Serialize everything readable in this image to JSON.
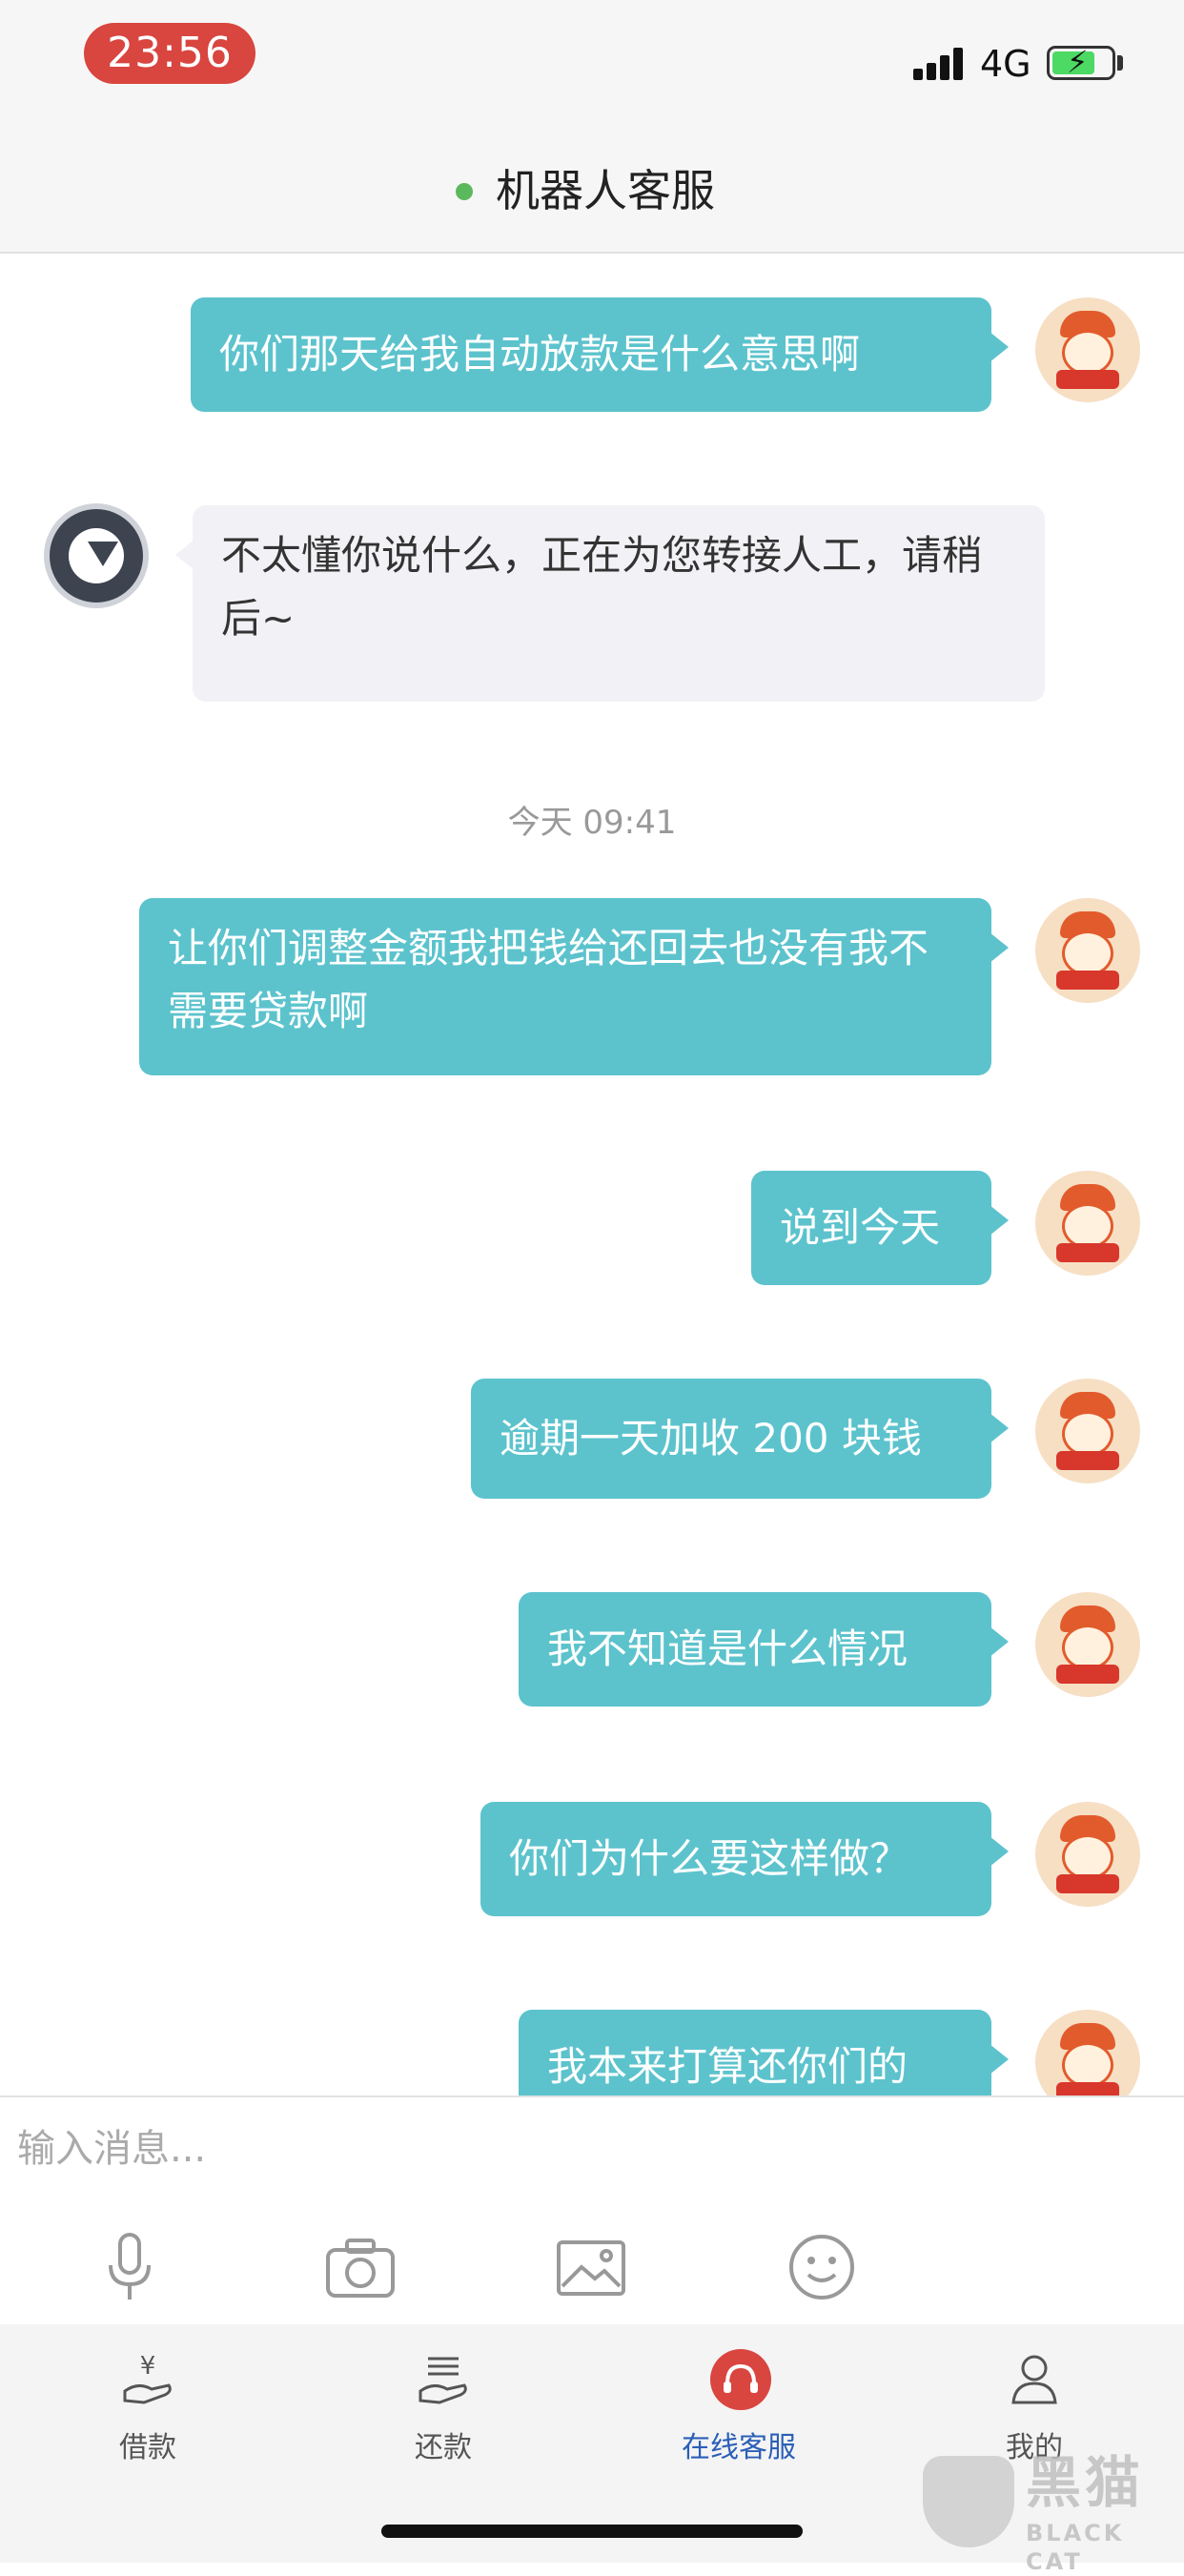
{
  "status_bar": {
    "time": "23:56",
    "network": "4G"
  },
  "header": {
    "title": "机器人客服",
    "online_color": "#5cb85c"
  },
  "messages": [
    {
      "sender": "user",
      "text": "你们那天给我自动放款是什么意思啊"
    },
    {
      "sender": "bot",
      "text": "不太懂你说什么，正在为您转接人工，请稍后~"
    },
    {
      "sender": "user",
      "text": "让你们调整金额我把钱给还回去也没有我不需要贷款啊"
    },
    {
      "sender": "user",
      "text": "说到今天"
    },
    {
      "sender": "user",
      "text": "逾期一天加收 200 块钱"
    },
    {
      "sender": "user",
      "text": "我不知道是什么情况"
    },
    {
      "sender": "user",
      "text": "你们为什么要这样做？"
    },
    {
      "sender": "user",
      "text": "我本来打算还你们的"
    }
  ],
  "timestamp": "今天 09:41",
  "input": {
    "placeholder": "输入消息..."
  },
  "toolbar": {
    "icons": [
      "microphone-icon",
      "camera-icon",
      "image-icon",
      "emoji-icon"
    ]
  },
  "tabs": [
    {
      "label": "借款",
      "icon": "loan-icon",
      "active": false
    },
    {
      "label": "还款",
      "icon": "repay-icon",
      "active": false
    },
    {
      "label": "在线客服",
      "icon": "headset-icon",
      "active": true
    },
    {
      "label": "我的",
      "icon": "profile-icon",
      "active": false
    }
  ],
  "colors": {
    "user_bubble": "#5cc3cd",
    "bot_bubble": "#f2f2f6",
    "active_tab": "#2b5fb7",
    "time_pill": "#d9453f"
  },
  "watermark": {
    "title": "黑猫",
    "subtitle": "BLACK CAT"
  }
}
